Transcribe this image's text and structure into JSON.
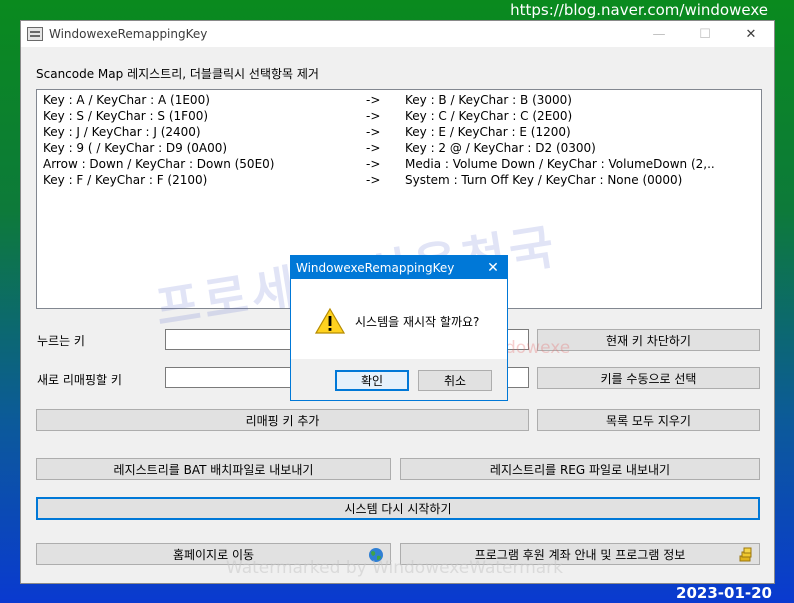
{
  "site_url": "https://blog.naver.com/windowexe",
  "date_stamp": "2023-01-20",
  "window": {
    "title": "WindowexeRemappingKey",
    "buttons": {
      "minimize": "—",
      "maximize": "☐",
      "close": "✕"
    }
  },
  "section_label": "Scancode Map 레지스트리, 더블클릭시 선택항목 제거",
  "mappings": [
    {
      "from": "Key : A / KeyChar : A (1E00)",
      "arrow": "->",
      "to": "Key : B / KeyChar : B (3000)"
    },
    {
      "from": "Key : S / KeyChar : S (1F00)",
      "arrow": "->",
      "to": "Key : C / KeyChar : C (2E00)"
    },
    {
      "from": "Key : J / KeyChar : J (2400)",
      "arrow": "->",
      "to": "Key : E / KeyChar : E (1200)"
    },
    {
      "from": "Key : 9 ( / KeyChar : D9 (0A00)",
      "arrow": "->",
      "to": "Key : 2 @ / KeyChar : D2 (0300)"
    },
    {
      "from": "Arrow : Down / KeyChar : Down (50E0)",
      "arrow": "->",
      "to": "Media : Volume Down / KeyChar : VolumeDown (2,.."
    },
    {
      "from": "Key : F / KeyChar : F (2100)",
      "arrow": "->",
      "to": "System : Turn Off Key / KeyChar : None (0000)"
    }
  ],
  "form": {
    "pressed_key_label": "누르는 키",
    "new_key_label": "새로 리매핑할 키",
    "block_key_button": "현재 키 차단하기",
    "manual_select_button": "키를 수동으로 선택",
    "add_remap_button": "리매핑 키 추가",
    "clear_all_button": "목록 모두 지우기",
    "export_bat_button": "레지스트리를 BAT 배치파일로 내보내기",
    "export_reg_button": "레지스트리를 REG 파일로 내보내기",
    "restart_button": "시스템 다시 시작하기",
    "homepage_button": "홈페이지로 이동",
    "donate_info_button": "프로그램 후원 계좌 안내 및 프로그램 정보"
  },
  "watermarks": {
    "big": "프로세스 사용천국",
    "red": "watermark by windowexe",
    "bottom": "Watermarked by WindowexeWatermark"
  },
  "dialog": {
    "title": "WindowexeRemappingKey",
    "close": "✕",
    "icon": "warning-icon",
    "message": "시스템을 재시작 할까요?",
    "ok": "확인",
    "cancel": "취소"
  },
  "colors": {
    "accent": "#0078d7",
    "window_bg": "#f0f0f0",
    "button_bg": "#e1e1e1"
  }
}
